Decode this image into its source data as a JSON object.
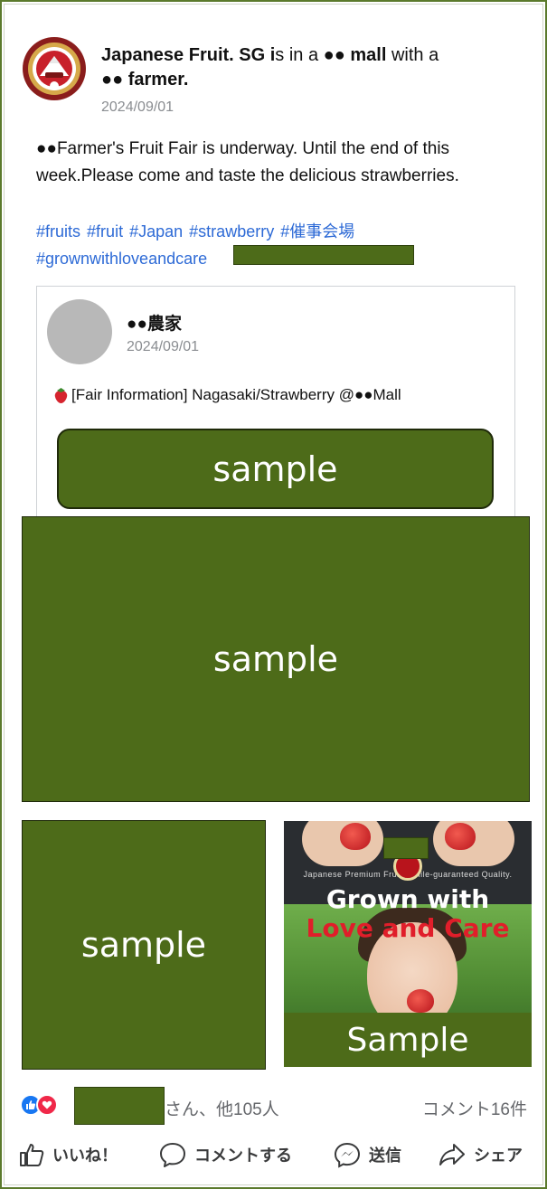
{
  "post": {
    "author_name": "Japanese Fruit. SG i",
    "header_part1": "s in a ",
    "mall_redacted": "●● mall",
    "header_part2": " with a",
    "farmer_redacted": "●● farmer.",
    "date": "2024/09/01",
    "text": "●●Farmer's Fruit Fair is underway. Until the end of this week.Please come and taste the delicious strawberries.",
    "hashtags": [
      "#fruits",
      "#fruit",
      "#Japan",
      "#strawberry",
      "#催事会場"
    ],
    "hashtag_line2": "#grownwithloveandcare"
  },
  "shared": {
    "name": "●●農家",
    "date": "2024/09/01",
    "text": "[Fair Information] Nagasaki/Strawberry @●●Mall",
    "sample_label": "sample"
  },
  "media": {
    "main_sample_label": "sample",
    "left_sample_label": "sample",
    "photo_caption": "Japanese Premium Fruit. Smile-guaranteed Quality.",
    "photo_title_1": "Grown with",
    "photo_title_2": "Love and Care",
    "photo_sample_label": "Sample"
  },
  "reactions": {
    "text": "さん、他105人",
    "comments": "コメント16件"
  },
  "actions": {
    "like": "いいね！",
    "comment": "コメントする",
    "send": "送信",
    "share": "シェア"
  },
  "colors": {
    "redaction": "#4d6b19",
    "link": "#2d6ad6",
    "like_blue": "#1877f2",
    "love_red": "#f02849"
  }
}
